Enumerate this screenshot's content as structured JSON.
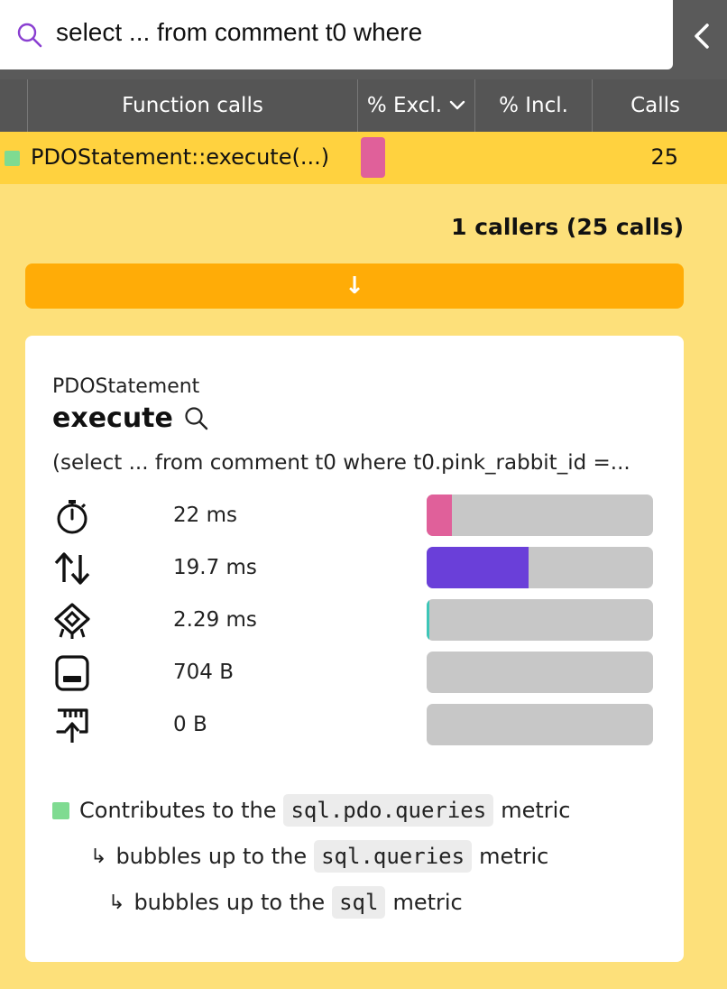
{
  "search": {
    "value": "select ... from comment t0 where"
  },
  "table": {
    "headers": {
      "function_calls": "Function calls",
      "excl": "% Excl.",
      "incl": "% Incl.",
      "calls": "Calls"
    },
    "selected_row": {
      "name": "PDOStatement::execute(...)",
      "calls": "25"
    }
  },
  "callers": {
    "label": "1 callers (25 calls)",
    "arrow": "↓"
  },
  "details": {
    "class_name": "PDOStatement",
    "method_name": "execute",
    "args": "(select ... from comment t0 where t0.pink_rabbit_id =...",
    "metrics": [
      {
        "icon": "stopwatch-icon",
        "value": "22 ms",
        "fraction": 0.11,
        "color": "#e0609a"
      },
      {
        "icon": "io-arrows-icon",
        "value": "19.7 ms",
        "fraction": 0.45,
        "color": "#6a3fd9"
      },
      {
        "icon": "cpu-chip-icon",
        "value": "2.29 ms",
        "fraction": 0.012,
        "color": "#3dc6b8"
      },
      {
        "icon": "memory-icon",
        "value": "704 B",
        "fraction": 0,
        "color": "#c7c7c7"
      },
      {
        "icon": "network-upload-icon",
        "value": "0 B",
        "fraction": 0,
        "color": "#c7c7c7"
      }
    ],
    "contributions": {
      "line1_prefix": "Contributes to the",
      "line1_metric": "sql.pdo.queries",
      "line1_suffix": "metric",
      "line2_prefix": "bubbles up to the",
      "line2_metric": "sql.queries",
      "line2_suffix": "metric",
      "line3_prefix": "bubbles up to the",
      "line3_metric": "sql",
      "line3_suffix": "metric"
    }
  }
}
